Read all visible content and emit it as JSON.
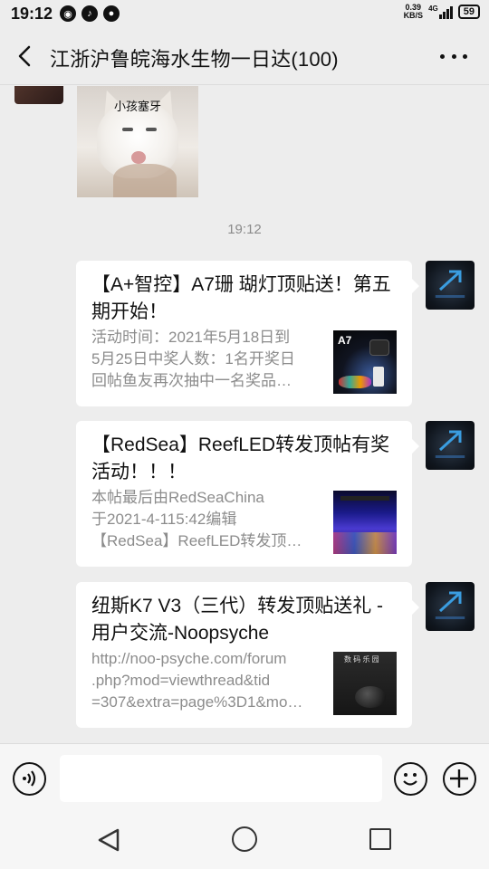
{
  "status": {
    "time": "19:12",
    "net_speed_value": "0.39",
    "net_speed_unit": "KB/S",
    "network": "4G",
    "battery": "59"
  },
  "header": {
    "title": "江浙沪鲁皖海水生物一日达(100)"
  },
  "chat": {
    "meme_caption": "小孩塞牙",
    "timestamp": "19:12",
    "messages": [
      {
        "title": "【A+智控】A7珊 瑚灯顶贴送！第五期开始！",
        "desc_lines": [
          "活动时间：2021年5月18日到",
          "5月25日中奖人数：1名开奖日",
          "回帖鱼友再次抽中一名奖品…"
        ],
        "thumb_label": "A7"
      },
      {
        "title": "【RedSea】ReefLED转发顶帖有奖活动！！！",
        "desc_lines": [
          "本帖最后由RedSeaChina",
          "于2021-4-115:42编辑",
          "【RedSea】ReefLED转发顶…"
        ]
      },
      {
        "title": "纽斯K7 V3（三代）转发顶贴送礼 - 用户交流-Noopsyche",
        "desc_lines": [
          "http://noo-psyche.com/forum",
          ".php?mod=viewthread&tid",
          "=307&extra=page%3D1&mo…"
        ],
        "thumb_label": "数 码 乐 园"
      }
    ]
  },
  "colors": {
    "background": "#ededed",
    "card": "#ffffff",
    "muted_text": "#8c8c8c",
    "avatar_accent": "#3a7dc9"
  },
  "icons": [
    "back-arrow-icon",
    "more-icon",
    "voice-icon",
    "emoji-icon",
    "plus-icon",
    "nav-back-icon",
    "nav-home-icon",
    "nav-recent-icon"
  ]
}
